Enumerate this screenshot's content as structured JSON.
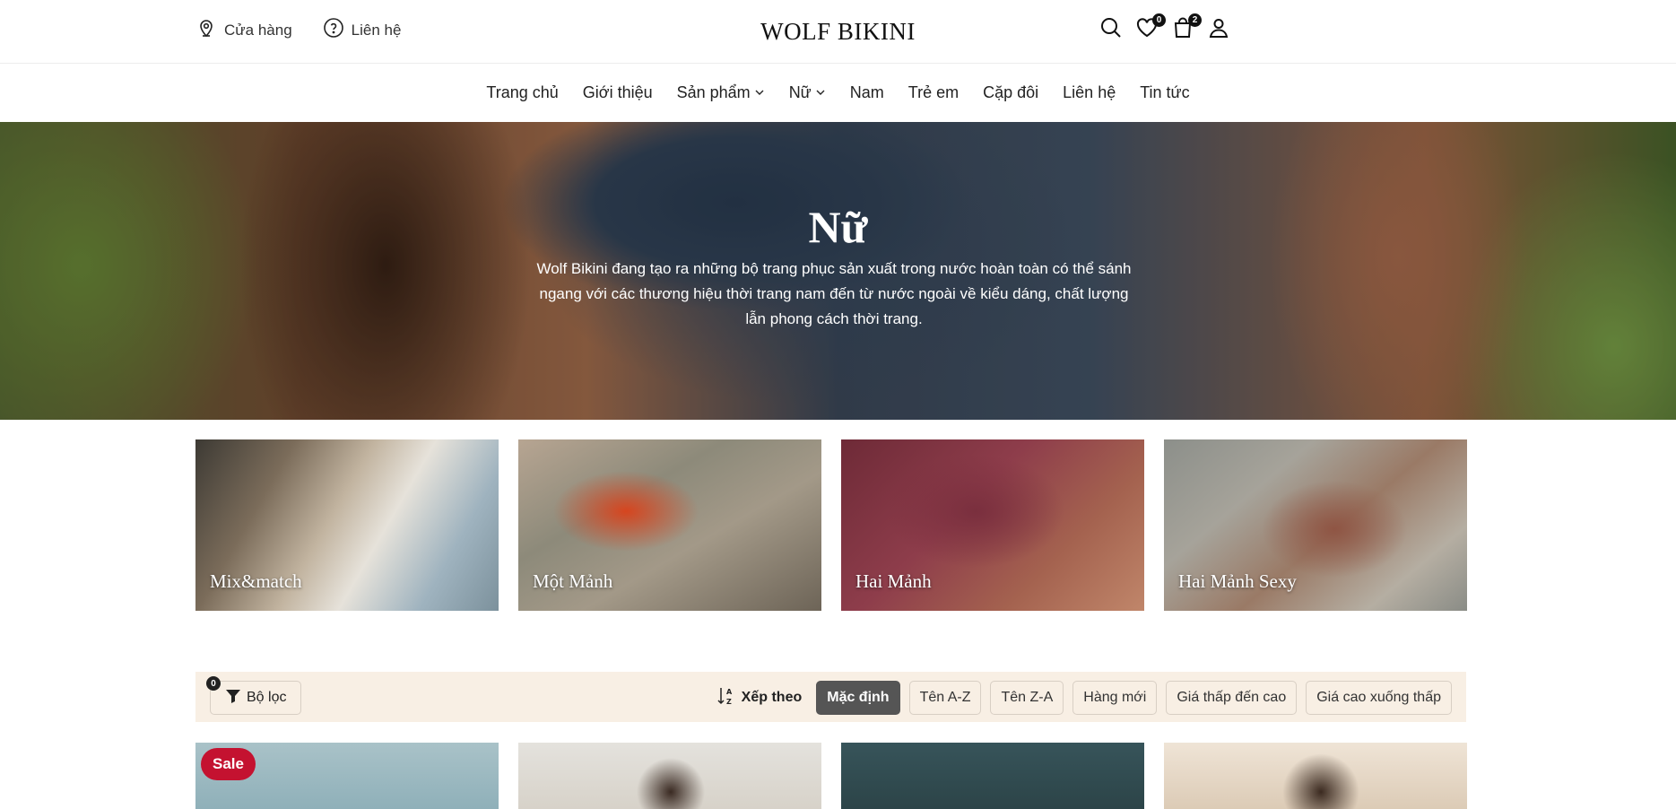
{
  "header": {
    "store_link": "Cửa hàng",
    "contact_link": "Liên hệ",
    "logo": "WOLF BIKINI",
    "wishlist_count": "0",
    "cart_count": "2",
    "icons": [
      "location-pin-icon",
      "question-circle-icon",
      "search-icon",
      "heart-icon",
      "shopping-bag-icon",
      "user-icon"
    ]
  },
  "nav": {
    "items": [
      {
        "label": "Trang chủ"
      },
      {
        "label": "Giới thiệu"
      },
      {
        "label": "Sản phẩm",
        "dropdown": true
      },
      {
        "label": "Nữ",
        "dropdown": true
      },
      {
        "label": "Nam"
      },
      {
        "label": "Trẻ em"
      },
      {
        "label": "Cặp đôi"
      },
      {
        "label": "Liên hệ"
      },
      {
        "label": "Tin tức"
      }
    ]
  },
  "hero": {
    "title": "Nữ",
    "description": "Wolf Bikini đang tạo ra những bộ trang phục sản xuất trong nước hoàn toàn có thể sánh ngang với các thương hiệu thời trang nam đến từ nước ngoài về kiểu dáng, chất lượng lẫn phong cách thời trang."
  },
  "categories": [
    {
      "label": "Mix&match"
    },
    {
      "label": "Một Mảnh"
    },
    {
      "label": "Hai Mảnh"
    },
    {
      "label": "Hai Mảnh Sexy"
    }
  ],
  "filter": {
    "filter_label": "Bộ lọc",
    "filter_count": "0",
    "sort_label": "Xếp theo",
    "sort_options": [
      {
        "label": "Mặc định",
        "active": true
      },
      {
        "label": "Tên A-Z"
      },
      {
        "label": "Tên Z-A"
      },
      {
        "label": "Hàng mới"
      },
      {
        "label": "Giá thấp đến cao"
      },
      {
        "label": "Giá cao xuống thấp"
      }
    ]
  },
  "products": [
    {
      "badge": "Sale"
    },
    {
      "badge": null
    },
    {
      "badge": null
    },
    {
      "badge": null
    }
  ],
  "colors": {
    "accent_sale": "#c41230",
    "filter_bar_bg": "#f8efe4",
    "active_chip": "#555555"
  }
}
